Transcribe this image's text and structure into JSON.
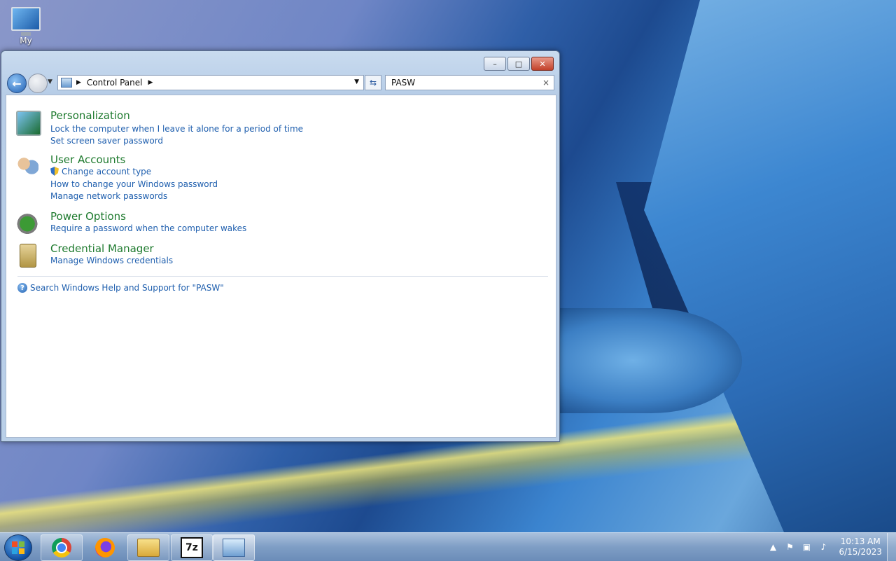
{
  "desktop": {
    "icons": [
      {
        "label": "My"
      }
    ]
  },
  "window": {
    "controls": {
      "minimize": "–",
      "maximize": "□",
      "close": "✕"
    },
    "address": {
      "segments": [
        "Control Panel"
      ]
    },
    "search": {
      "value": "PASW",
      "clear": "×"
    },
    "results": [
      {
        "title": "Personalization",
        "icon": "personalization-icon",
        "links": [
          "Lock the computer when I leave it alone for a period of time",
          "Set screen saver password"
        ]
      },
      {
        "title": "User Accounts",
        "icon": "user-accounts-icon",
        "links": [
          "Change account type",
          "How to change your Windows password",
          "Manage network passwords"
        ]
      },
      {
        "title": "Power Options",
        "icon": "power-options-icon",
        "links": [
          "Require a password when the computer wakes"
        ]
      },
      {
        "title": "Credential Manager",
        "icon": "credential-manager-icon",
        "links": [
          "Manage Windows credentials"
        ]
      }
    ],
    "help_link": "Search Windows Help and Support for \"PASW\""
  },
  "taskbar": {
    "apps": [
      "chrome-icon",
      "firefox-icon",
      "file-explorer-icon",
      "7zip-icon",
      "control-panel-icon"
    ],
    "zip_label": "7z",
    "clock": {
      "time": "10:13 AM",
      "date": "6/15/2023"
    }
  },
  "colors": {
    "link": "#1f5fae",
    "group_title": "#1e7a2e"
  }
}
